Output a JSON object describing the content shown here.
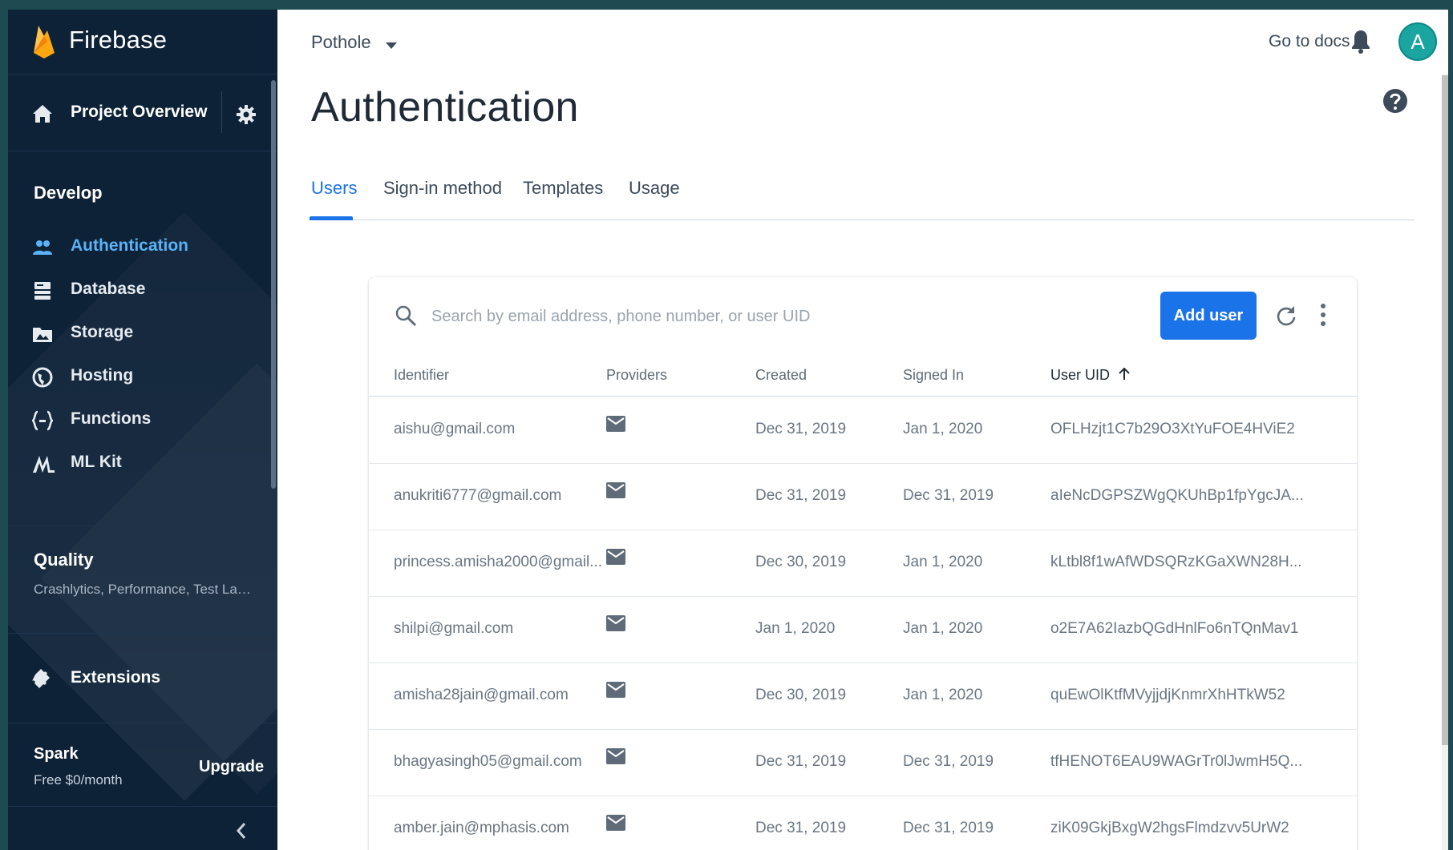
{
  "sidebar": {
    "brand": "Firebase",
    "project_overview": "Project Overview",
    "develop_header": "Develop",
    "develop_items": [
      {
        "label": "Authentication",
        "icon": "people-icon",
        "active": true
      },
      {
        "label": "Database",
        "icon": "database-icon",
        "active": false
      },
      {
        "label": "Storage",
        "icon": "storage-icon",
        "active": false
      },
      {
        "label": "Hosting",
        "icon": "globe-icon",
        "active": false
      },
      {
        "label": "Functions",
        "icon": "functions-icon",
        "active": false
      },
      {
        "label": "ML Kit",
        "icon": "mlkit-icon",
        "active": false
      }
    ],
    "quality_header": "Quality",
    "quality_sub": "Crashlytics, Performance, Test La…",
    "extensions": "Extensions",
    "plan_name": "Spark",
    "plan_price": "Free $0/month",
    "upgrade": "Upgrade"
  },
  "header": {
    "project": "Pothole",
    "go_to_docs": "Go to docs",
    "avatar_initial": "A"
  },
  "page": {
    "title": "Authentication",
    "tabs": [
      {
        "label": "Users",
        "active": true
      },
      {
        "label": "Sign-in method",
        "active": false
      },
      {
        "label": "Templates",
        "active": false
      },
      {
        "label": "Usage",
        "active": false
      }
    ]
  },
  "users": {
    "search_placeholder": "Search by email address, phone number, or user UID",
    "add_user": "Add user",
    "columns": [
      "Identifier",
      "Providers",
      "Created",
      "Signed In",
      "User UID"
    ],
    "rows": [
      {
        "identifier": "aishu@gmail.com",
        "created": "Dec 31, 2019",
        "signed_in": "Jan 1, 2020",
        "uid": "OFLHzjt1C7b29O3XtYuFOE4HViE2"
      },
      {
        "identifier": "anukriti6777@gmail.com",
        "created": "Dec 31, 2019",
        "signed_in": "Dec 31, 2019",
        "uid": "aIeNcDGPSZWgQKUhBp1fpYgcJA..."
      },
      {
        "identifier": "princess.amisha2000@gmail...",
        "created": "Dec 30, 2019",
        "signed_in": "Jan 1, 2020",
        "uid": "kLtbl8f1wAfWDSQRzKGaXWN28H..."
      },
      {
        "identifier": "shilpi@gmail.com",
        "created": "Jan 1, 2020",
        "signed_in": "Jan 1, 2020",
        "uid": "o2E7A62IazbQGdHnlFo6nTQnMav1"
      },
      {
        "identifier": "amisha28jain@gmail.com",
        "created": "Dec 30, 2019",
        "signed_in": "Jan 1, 2020",
        "uid": "quEwOlKtfMVyjjdjKnmrXhHTkW52"
      },
      {
        "identifier": "bhagyasingh05@gmail.com",
        "created": "Dec 31, 2019",
        "signed_in": "Dec 31, 2019",
        "uid": "tfHENOT6EAU9WAGrTr0lJwmH5Q..."
      },
      {
        "identifier": "amber.jain@mphasis.com",
        "created": "Dec 31, 2019",
        "signed_in": "Dec 31, 2019",
        "uid": "ziK09GkjBxgW2hgsFlmdzvv5UrW2"
      }
    ]
  },
  "colors": {
    "sidebar_bg": "#0d2137",
    "accent": "#1a73e8",
    "active_nav": "#5ab2f7",
    "avatar": "#1aa5a0"
  }
}
